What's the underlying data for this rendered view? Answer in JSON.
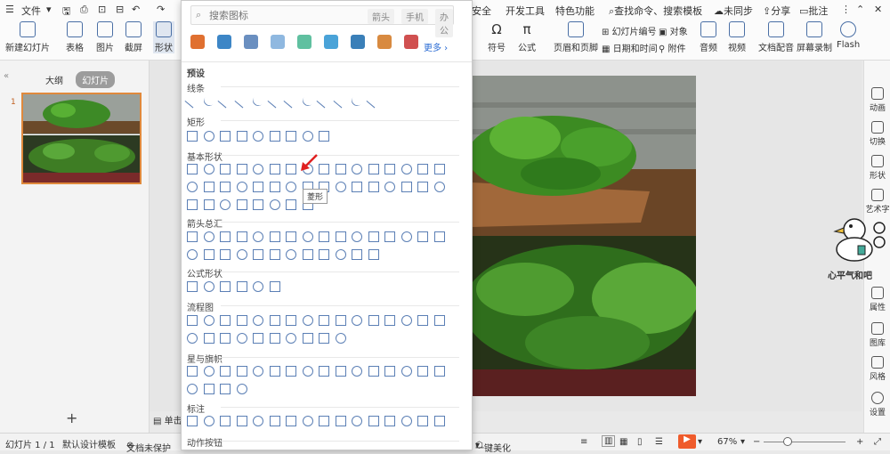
{
  "menu": {
    "file": "文件",
    "security": "安全",
    "devtools": "开发工具",
    "special": "特色功能",
    "search": "查找命令、搜索模板",
    "sync": "未同步",
    "share": "分享",
    "comment": "批注"
  },
  "toolbar": {
    "new_slide": "新建幻灯片",
    "table": "表格",
    "picture": "图片",
    "screenshot": "截屏",
    "shape": "形状",
    "symbol": "符号",
    "formula": "公式",
    "header_footer": "页眉和页脚",
    "slide_number": "幻灯片编号",
    "datetime": "日期和时间",
    "object": "对象",
    "attachment": "附件",
    "audio": "音频",
    "video": "视频",
    "text_dub": "文档配音",
    "screen_record": "屏幕录制",
    "flash": "Flash"
  },
  "left": {
    "tab_outline": "大纲",
    "tab_slides": "幻灯片",
    "slide_num": "1",
    "add": "+"
  },
  "notes_partial": "单击",
  "popup": {
    "search_placeholder": "搜索图标",
    "tags": [
      "箭头",
      "手机",
      "办公"
    ],
    "more": "更多",
    "preset": "预设",
    "sections": [
      "线条",
      "矩形",
      "基本形状",
      "箭头总汇",
      "公式形状",
      "流程图",
      "星与旗帜",
      "标注",
      "动作按钮"
    ],
    "tooltip": "菱形"
  },
  "right": [
    "动画",
    "切换",
    "形状",
    "艺术字",
    "属性",
    "图库",
    "风格",
    "设置"
  ],
  "status": {
    "slide_of": "幻灯片 1 / 1",
    "template": "默认设计模板",
    "unsaved": "文档未保护",
    "beautify": "一键美化",
    "zoom": "67%"
  },
  "watermark": "心平气和吧"
}
